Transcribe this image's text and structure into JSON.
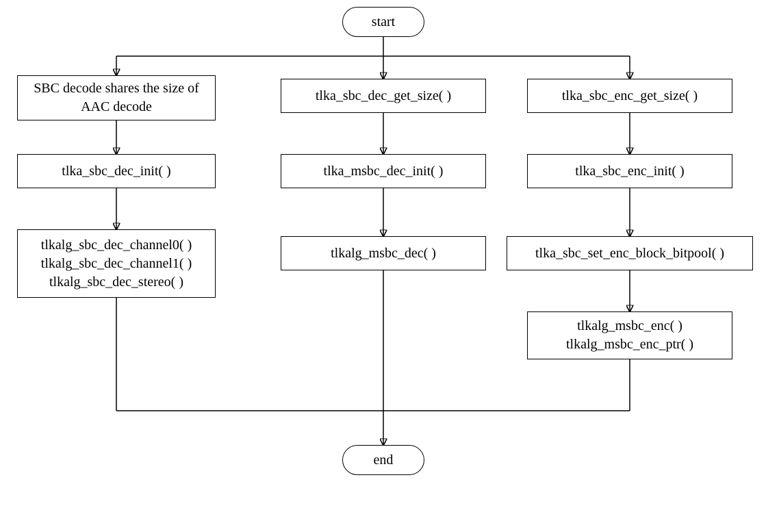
{
  "terminators": {
    "start": "start",
    "end": "end"
  },
  "columns": {
    "left": {
      "n1": "SBC decode shares the size of AAC decode",
      "n2": "tlka_sbc_dec_init( )",
      "n3": {
        "line1": "tlkalg_sbc_dec_channel0( )",
        "line2": "tlkalg_sbc_dec_channel1( )",
        "line3": "tlkalg_sbc_dec_stereo( )"
      }
    },
    "mid": {
      "n1": "tlka_sbc_dec_get_size( )",
      "n2": "tlka_msbc_dec_init( )",
      "n3": "tlkalg_msbc_dec( )"
    },
    "right": {
      "n1": "tlka_sbc_enc_get_size( )",
      "n2": "tlka_sbc_enc_init( )",
      "n3": "tlka_sbc_set_enc_block_bitpool( )",
      "n4": {
        "line1": "tlkalg_msbc_enc( )",
        "line2": "tlkalg_msbc_enc_ptr( )"
      }
    }
  }
}
